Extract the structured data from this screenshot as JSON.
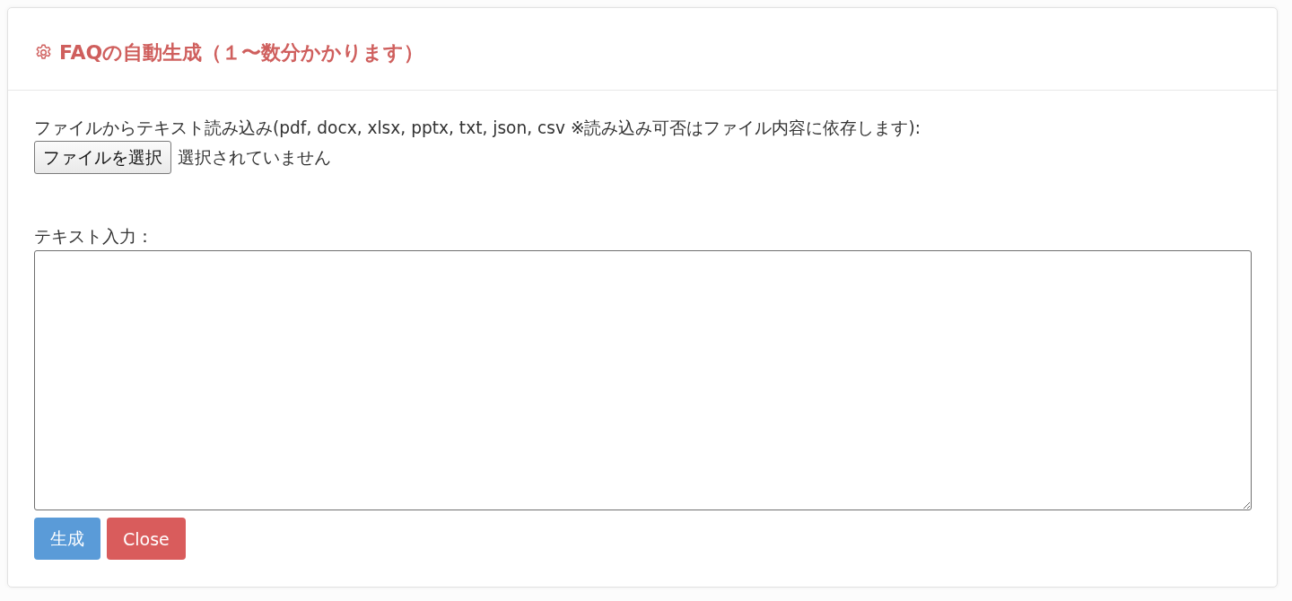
{
  "dialog": {
    "title": "FAQの自動生成（１〜数分かかります）",
    "file_input": {
      "label": "ファイルからテキスト読み込み(pdf, docx, xlsx, pptx, txt, json, csv ※読み込み可否はファイル内容に依存します):",
      "button": "ファイルを選択",
      "status": "選択されていません"
    },
    "text_input": {
      "label": "テキスト入力："
    },
    "buttons": [
      {
        "label": "生成",
        "kind": "primary"
      },
      {
        "label": "Close",
        "kind": "danger"
      }
    ]
  }
}
